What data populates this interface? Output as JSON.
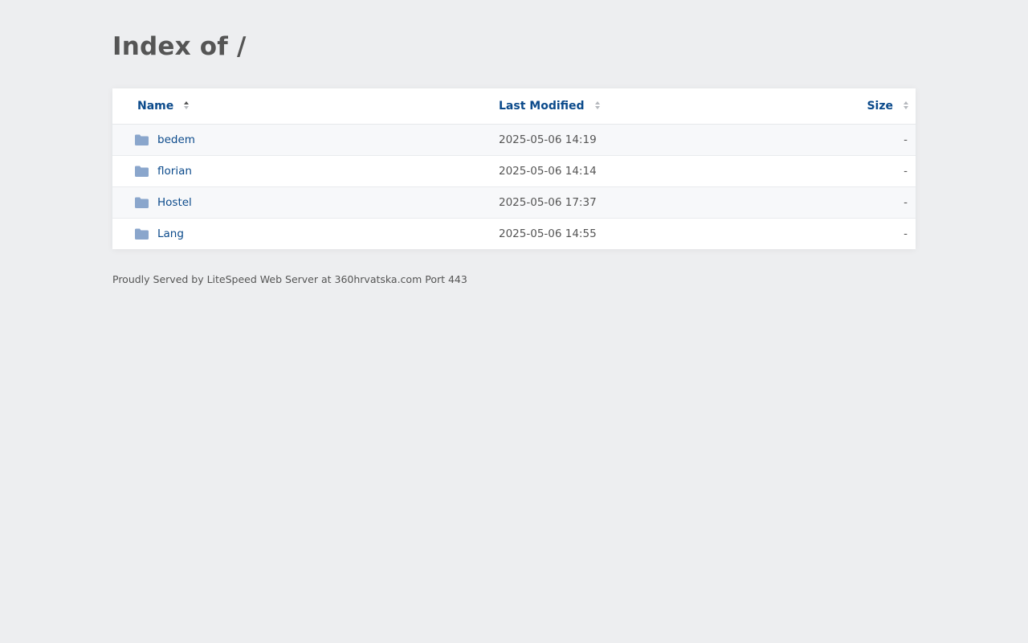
{
  "page": {
    "title": "Index of /"
  },
  "colors": {
    "background": "#edeef0",
    "link": "#0b4a8b",
    "folder_icon": "#8aa6cc",
    "text": "#555555"
  },
  "table": {
    "headers": {
      "name": "Name",
      "last_modified": "Last Modified",
      "size": "Size"
    },
    "rows": [
      {
        "icon": "folder-icon",
        "name": "bedem",
        "last_modified": "2025-05-06 14:19",
        "size": "-"
      },
      {
        "icon": "folder-icon",
        "name": "florian",
        "last_modified": "2025-05-06 14:14",
        "size": "-"
      },
      {
        "icon": "folder-icon",
        "name": "Hostel",
        "last_modified": "2025-05-06 17:37",
        "size": "-"
      },
      {
        "icon": "folder-icon",
        "name": "Lang",
        "last_modified": "2025-05-06 14:55",
        "size": "-"
      }
    ]
  },
  "footer": {
    "text": "Proudly Served by LiteSpeed Web Server at 360hrvatska.com Port 443"
  }
}
